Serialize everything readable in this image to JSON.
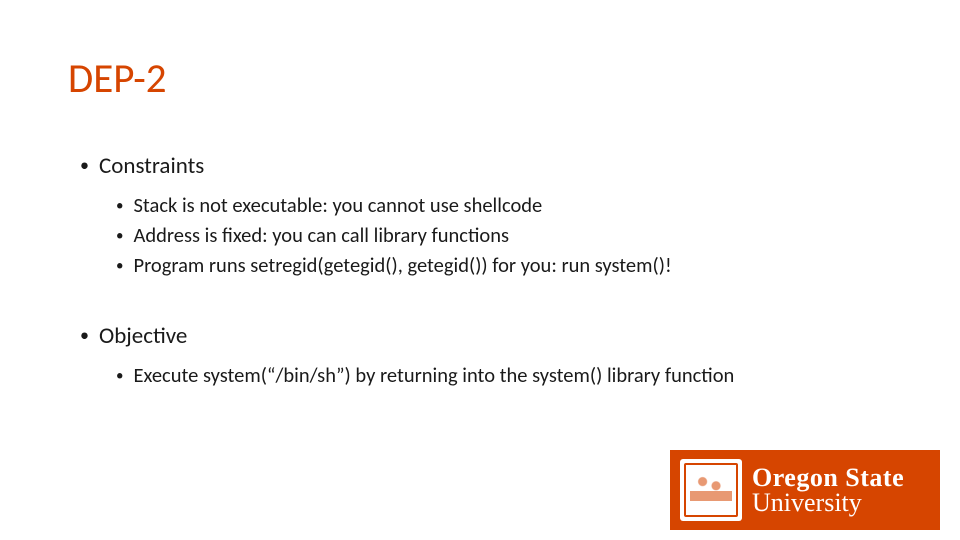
{
  "title": "DEP-2",
  "section1": {
    "heading": "Constraints",
    "items": [
      "Stack is not executable: you cannot use shellcode",
      "Address is fixed: you can call library functions",
      "Program runs setregid(getegid(), getegid()) for you: run system()!"
    ]
  },
  "section2": {
    "heading": "Objective",
    "items": [
      "Execute system(“/bin/sh”) by returning into the system() library function"
    ]
  },
  "logo": {
    "line1": "Oregon State",
    "line2": "University"
  }
}
